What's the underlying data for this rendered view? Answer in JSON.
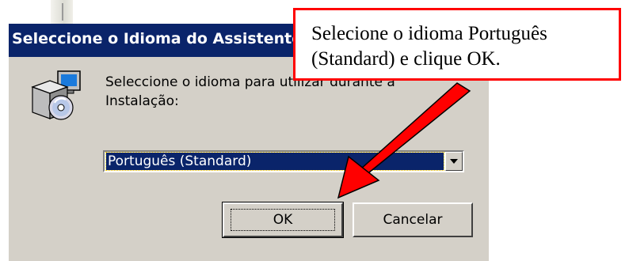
{
  "dialog": {
    "title": "Seleccione o Idioma do Assistente de Instalação",
    "prompt_line1": "Seleccione o idioma para utilizar durante a",
    "prompt_line2": "Instalação:",
    "language_select": {
      "selected": "Português (Standard)"
    },
    "ok_label": "OK",
    "cancel_label": "Cancelar"
  },
  "callout": {
    "line1": "Selecione o idioma Português",
    "line2": "(Standard) e clique OK."
  },
  "colors": {
    "titlebar": "#0a246a",
    "dialog_face": "#d4d0c8",
    "selection": "#0a246a",
    "callout_border": "#ff0000",
    "arrow": "#ff0000"
  },
  "icons": [
    "setup-installer-icon",
    "chevron-down-icon"
  ]
}
